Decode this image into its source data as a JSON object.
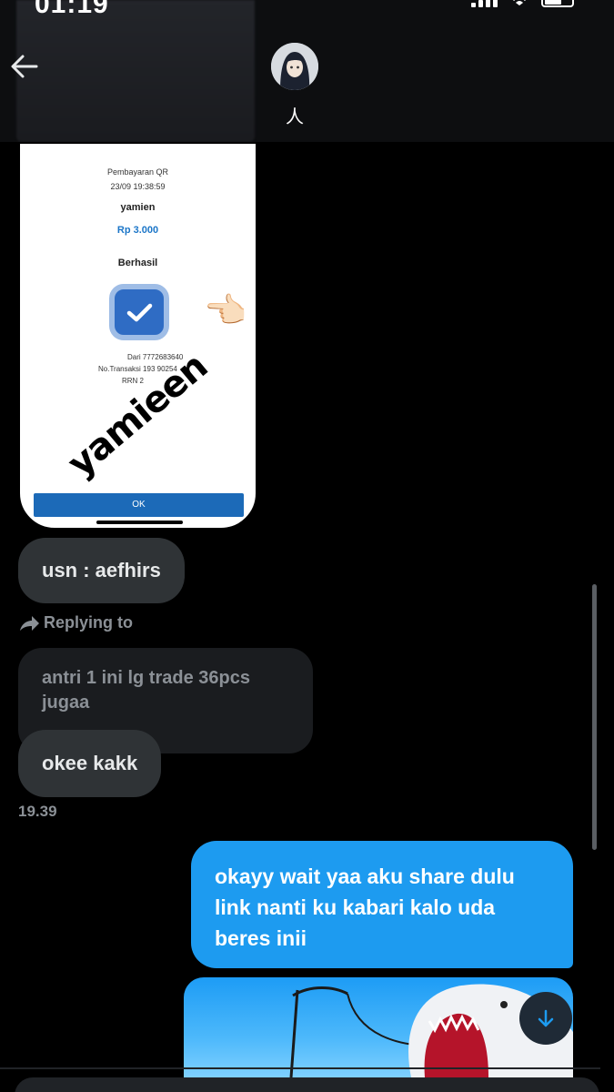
{
  "status_bar": {
    "time": "01:19"
  },
  "header": {
    "contact_name": "人"
  },
  "receipt": {
    "title": "Pembayaran QR",
    "date": "23/09 19:38:59",
    "name": "yamien",
    "amount": "Rp 3.000",
    "status": "Berhasil",
    "from": "Dari 7772683640",
    "transaction": "No.Transaksi 193 90254",
    "rrn": "RRN 2",
    "signature": "yamieen",
    "hand_emoji": "👈🏻",
    "ok_label": "OK"
  },
  "messages": {
    "usn": "usn : aefhirs",
    "replying_to": "Replying to",
    "quoted": "antri 1 ini lg trade 36pcs jugaa",
    "okee": "okee kakk",
    "time": "19.39",
    "outgoing": "okayy wait yaa aku share dulu link nanti ku kabari kalo uda beres inii"
  },
  "colors": {
    "background": "#000000",
    "incoming_bubble": "#2f3336",
    "outgoing_bubble": "#1d9bf0",
    "muted_text": "#8b9096"
  },
  "icons": {
    "back": "arrow-left-icon",
    "reply": "reply-arrow-icon",
    "scroll_down": "arrow-down-icon"
  }
}
